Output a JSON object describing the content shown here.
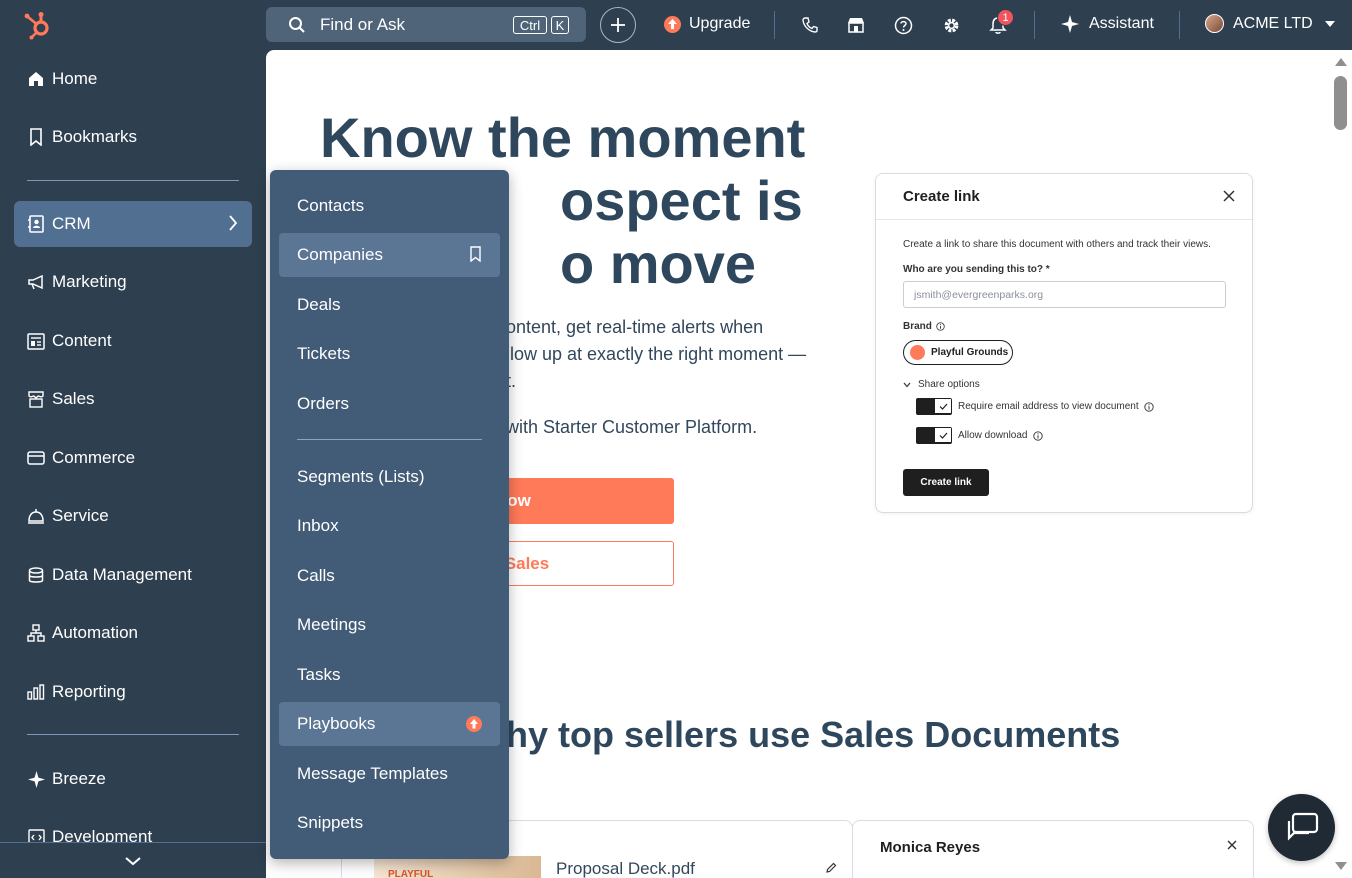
{
  "topbar": {
    "search_label": "Find or Ask",
    "kbd_ctrl": "Ctrl",
    "kbd_k": "K",
    "upgrade_label": "Upgrade",
    "notifications_count": "1",
    "assistant_label": "Assistant",
    "account_name": "ACME LTD"
  },
  "sidebar": {
    "items": [
      {
        "label": "Home",
        "icon": "home-icon"
      },
      {
        "label": "Bookmarks",
        "icon": "bookmark-icon"
      },
      {
        "label": "CRM",
        "icon": "crm-icon"
      },
      {
        "label": "Marketing",
        "icon": "megaphone-icon"
      },
      {
        "label": "Content",
        "icon": "content-icon"
      },
      {
        "label": "Sales",
        "icon": "sales-icon"
      },
      {
        "label": "Commerce",
        "icon": "commerce-icon"
      },
      {
        "label": "Service",
        "icon": "bell-service-icon"
      },
      {
        "label": "Data Management",
        "icon": "database-icon"
      },
      {
        "label": "Automation",
        "icon": "automation-icon"
      },
      {
        "label": "Reporting",
        "icon": "reporting-icon"
      },
      {
        "label": "Breeze",
        "icon": "sparkle-icon"
      },
      {
        "label": "Development",
        "icon": "code-icon"
      }
    ]
  },
  "crm_menu": {
    "items": [
      {
        "label": "Contacts"
      },
      {
        "label": "Companies"
      },
      {
        "label": "Deals"
      },
      {
        "label": "Tickets"
      },
      {
        "label": "Orders"
      },
      {
        "label": "Segments (Lists)"
      },
      {
        "label": "Inbox"
      },
      {
        "label": "Calls"
      },
      {
        "label": "Meetings"
      },
      {
        "label": "Tasks"
      },
      {
        "label": "Playbooks"
      },
      {
        "label": "Message Templates"
      },
      {
        "label": "Snippets"
      }
    ]
  },
  "hero": {
    "title_line1": "Know the moment",
    "title_line2": "ospect is",
    "title_line3": "o move",
    "desc_line1": "ontent, get real-time alerts when",
    "desc_line2": "llow up at exactly the right moment —",
    "desc_line3": "t.",
    "sub": "with Starter Customer Platform.",
    "cta_primary": "ow",
    "cta_secondary": "Sales"
  },
  "create_link_card": {
    "title": "Create link",
    "description": "Create a link to share this document with others and track their views.",
    "recipient_label": "Who are you sending this to? *",
    "recipient_placeholder": "jsmith@evergreenparks.org",
    "brand_label": "Brand",
    "brand_value": "Playful Grounds",
    "share_options_label": "Share options",
    "option_email": "Require email address to view document",
    "option_download": "Allow download",
    "create_button": "Create link"
  },
  "section": {
    "title": "hy top sellers use Sales Documents"
  },
  "preview": {
    "file_name": "Proposal Deck.pdf",
    "thumb_text": "PLAYFUL",
    "person_name": "Monica Reyes"
  },
  "colors": {
    "nav_bg": "#2e3f50",
    "flyout_bg": "#425b76",
    "accent": "#ff7a59",
    "badge": "#f2545b"
  }
}
